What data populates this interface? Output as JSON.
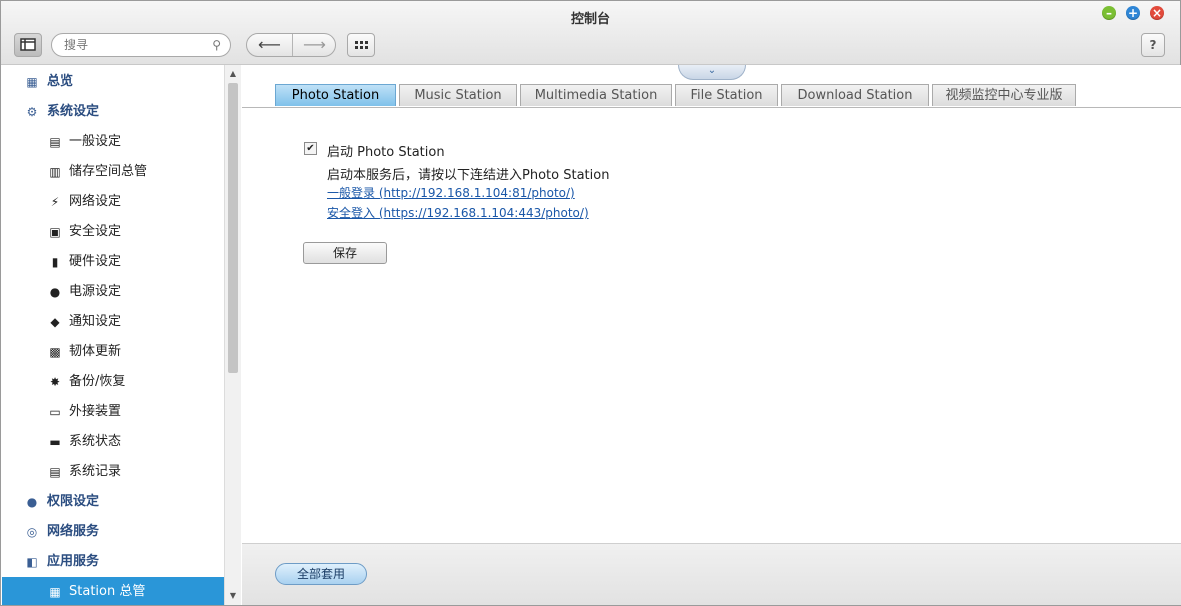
{
  "window": {
    "title": "控制台"
  },
  "toolbar": {
    "search_placeholder": "搜寻",
    "help_label": "?"
  },
  "sidebar": {
    "items": [
      {
        "label": "总览",
        "level": "top",
        "icon": "overview-icon",
        "glyph": "▦"
      },
      {
        "label": "系统设定",
        "level": "top",
        "icon": "system-settings-icon",
        "glyph": "⚙"
      },
      {
        "label": "一般设定",
        "level": "sub",
        "icon": "general-settings-icon",
        "glyph": "▤"
      },
      {
        "label": "储存空间总管",
        "level": "sub",
        "icon": "storage-manager-icon",
        "glyph": "▥"
      },
      {
        "label": "网络设定",
        "level": "sub",
        "icon": "network-settings-icon",
        "glyph": "⚡"
      },
      {
        "label": "安全设定",
        "level": "sub",
        "icon": "security-lock-icon",
        "glyph": "▣"
      },
      {
        "label": "硬件设定",
        "level": "sub",
        "icon": "hardware-icon",
        "glyph": "▮"
      },
      {
        "label": "电源设定",
        "level": "sub",
        "icon": "power-bulb-icon",
        "glyph": "●"
      },
      {
        "label": "通知设定",
        "level": "sub",
        "icon": "notification-icon",
        "glyph": "◆"
      },
      {
        "label": "韧体更新",
        "level": "sub",
        "icon": "firmware-update-icon",
        "glyph": "▩"
      },
      {
        "label": "备份/恢复",
        "level": "sub",
        "icon": "backup-restore-icon",
        "glyph": "✸"
      },
      {
        "label": "外接装置",
        "level": "sub",
        "icon": "external-device-icon",
        "glyph": "▭"
      },
      {
        "label": "系统状态",
        "level": "sub",
        "icon": "system-status-icon",
        "glyph": "▬"
      },
      {
        "label": "系统记录",
        "level": "sub",
        "icon": "system-log-icon",
        "glyph": "▤"
      },
      {
        "label": "权限设定",
        "level": "top",
        "icon": "user-privilege-icon",
        "glyph": "●"
      },
      {
        "label": "网络服务",
        "level": "top",
        "icon": "network-services-icon",
        "glyph": "◎"
      },
      {
        "label": "应用服务",
        "level": "top",
        "icon": "application-services-icon",
        "glyph": "◧"
      },
      {
        "label": "Station 总管",
        "level": "sub",
        "icon": "station-manager-icon",
        "glyph": "▦",
        "active": true
      }
    ]
  },
  "tabs": [
    {
      "label": "Photo Station",
      "active": true
    },
    {
      "label": "Music Station"
    },
    {
      "label": "Multimedia Station"
    },
    {
      "label": "File Station"
    },
    {
      "label": "Download Station"
    },
    {
      "label": "视频监控中心专业版"
    }
  ],
  "photo_station": {
    "enable_label": "启动 Photo Station",
    "enable_checked": true,
    "hint": "启动本服务后，请按以下连结进入Photo Station",
    "link_normal": "一般登录 (http://192.168.1.104:81/photo/)",
    "link_secure": "安全登入 (https://192.168.1.104:443/photo/)",
    "save_label": "保存"
  },
  "footer": {
    "apply_all_label": "全部套用"
  }
}
